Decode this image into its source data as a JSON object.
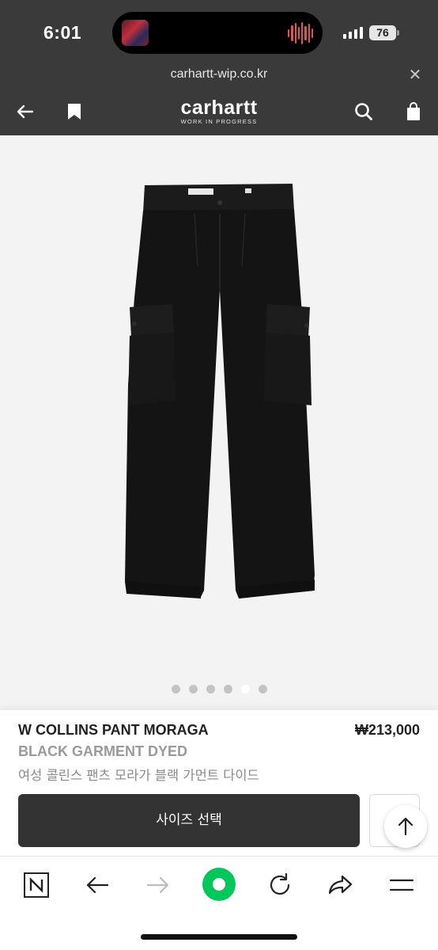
{
  "status_bar": {
    "time": "6:01",
    "battery": "76"
  },
  "browser": {
    "url": "carhartt-wip.co.kr",
    "close_icon": "close-icon"
  },
  "header": {
    "brand_name": "carhartt",
    "brand_tagline": "WORK IN PROGRESS",
    "icons": [
      "back-arrow-icon",
      "bookmark-icon",
      "search-icon",
      "shopping-bag-icon"
    ]
  },
  "gallery": {
    "image": "black-cargo-pants",
    "slides_total": 6,
    "active_slide": 5
  },
  "product": {
    "name": "W COLLINS PANT MORAGA",
    "price": "₩213,000",
    "color": "BLACK GARMENT DYED",
    "korean_name": "여성 콜린스 팬츠 모라가 블랙 가먼트 다이드",
    "size_button_label": "사이즈 선택"
  },
  "toolbar": {
    "items": [
      "naver-n-icon",
      "back-arrow-icon",
      "forward-arrow-icon",
      "naver-green-button",
      "reload-icon",
      "share-icon",
      "menu-icon"
    ]
  },
  "colors": {
    "header_bg": "#3a3a3a",
    "gallery_bg": "#f3f3f3",
    "button_bg": "#333333",
    "naver_green": "#03c75a"
  }
}
